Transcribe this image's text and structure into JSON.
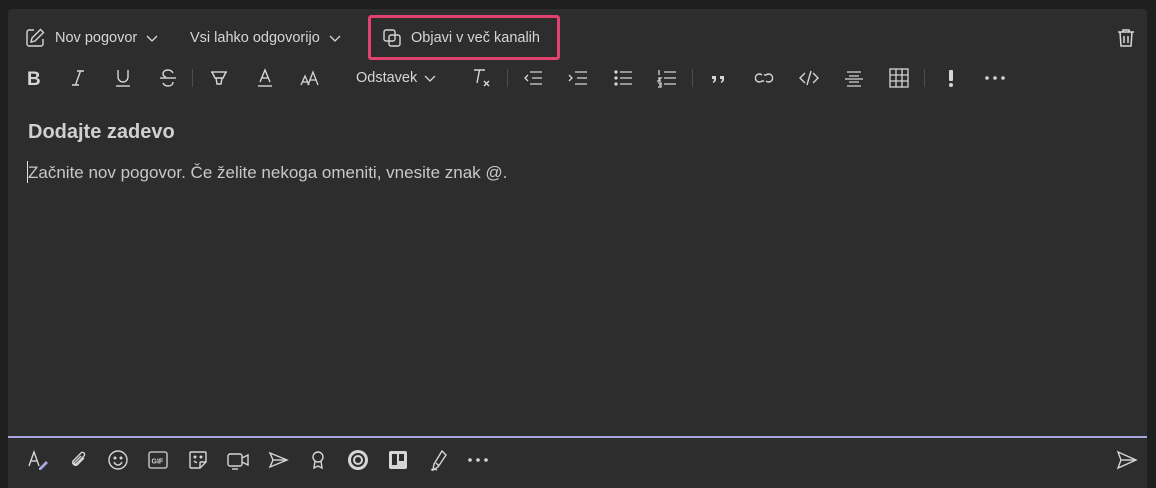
{
  "toolbar": {
    "new_conversation_label": "Nov pogovor",
    "reply_setting_label": "Vsi lahko odgovorijo",
    "post_multiple_label": "Objavi v več kanalih",
    "paragraph_label": "Odstavek"
  },
  "editor": {
    "subject_placeholder": "Dodajte zadevo",
    "body_placeholder": "Začnite nov pogovor. Če želite nekoga omeniti, vnesite znak @."
  },
  "colors": {
    "highlight": "#e0436f",
    "accent_underline": "#a6a7dc",
    "format_icon": "#a6a7dc"
  },
  "icons": {
    "format_toolbar": [
      "bold-icon",
      "italic-icon",
      "underline-icon",
      "strikethrough-icon",
      "highlight-icon",
      "font-color-icon",
      "font-size-icon",
      "clear-format-icon",
      "decrease-indent-icon",
      "increase-indent-icon",
      "bulleted-list-icon",
      "numbered-list-icon",
      "quote-icon",
      "link-icon",
      "code-icon",
      "horizontal-rule-icon",
      "table-icon",
      "important-icon",
      "more-options-icon"
    ],
    "bottom_toolbar": [
      "format-icon",
      "attach-icon",
      "emoji-icon",
      "gif-icon",
      "sticker-icon",
      "meet-now-icon",
      "stream-icon",
      "praise-icon",
      "loop-icon",
      "trello-icon",
      "approvals-icon",
      "more-apps-icon",
      "send-icon"
    ]
  }
}
